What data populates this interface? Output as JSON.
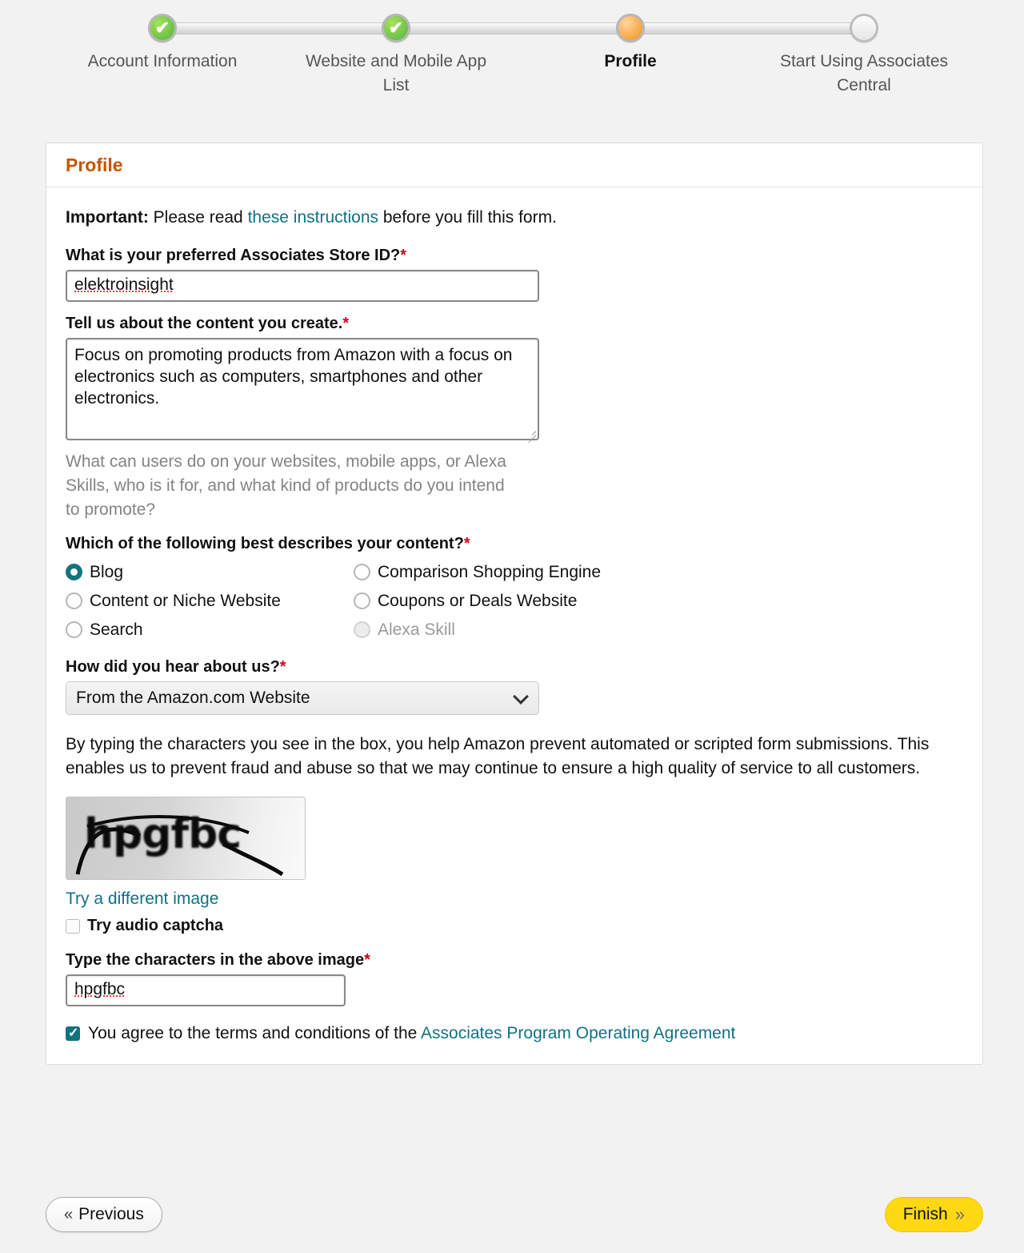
{
  "tracker": {
    "steps": [
      {
        "label": "Account Information",
        "state": "done",
        "icon": "check-icon"
      },
      {
        "label": "Website and Mobile App List",
        "state": "done",
        "icon": "check-icon"
      },
      {
        "label": "Profile",
        "state": "active",
        "icon": "current-step-icon"
      },
      {
        "label": "Start Using Associates Central",
        "state": "todo",
        "icon": "pending-step-icon"
      }
    ]
  },
  "card": {
    "title": "Profile",
    "important_prefix": "Important:",
    "important_text_before": " Please read ",
    "important_link": "these instructions",
    "important_text_after": " before you fill this form."
  },
  "fields": {
    "store_id": {
      "label": "What is your preferred Associates Store ID?",
      "required_mark": "*",
      "value": "elektroinsight"
    },
    "content_description": {
      "label": "Tell us about the content you create.",
      "required_mark": "*",
      "value": "Focus on promoting products from Amazon with a focus on electronics such as computers, smartphones and other electronics.",
      "hint": "What can users do on your websites, mobile apps, or Alexa Skills, who is it for, and what kind of products do you intend to promote?"
    },
    "content_type": {
      "label": "Which of the following best describes your content?",
      "required_mark": "*",
      "options": [
        {
          "label": "Blog",
          "selected": true,
          "disabled": false
        },
        {
          "label": "Comparison Shopping Engine",
          "selected": false,
          "disabled": false
        },
        {
          "label": "Content or Niche Website",
          "selected": false,
          "disabled": false
        },
        {
          "label": "Coupons or Deals Website",
          "selected": false,
          "disabled": false
        },
        {
          "label": "Search",
          "selected": false,
          "disabled": false
        },
        {
          "label": "Alexa Skill",
          "selected": false,
          "disabled": true
        }
      ]
    },
    "how_heard": {
      "label": "How did you hear about us?",
      "required_mark": "*",
      "value": "From the Amazon.com Website"
    }
  },
  "captcha": {
    "paragraph": "By typing the characters you see in the box, you help Amazon prevent automated or scripted form submissions. This enables us to prevent fraud and abuse so that we may continue to ensure a high quality of service to all customers.",
    "image_text": "hpgfbc",
    "try_different_link": "Try a different image",
    "audio_label": "Try audio captcha",
    "audio_checked": false,
    "input_label": "Type the characters in the above image",
    "required_mark": "*",
    "input_value": "hpgfbc"
  },
  "terms": {
    "checked": true,
    "text": "You agree to the terms and conditions of the ",
    "link": "Associates Program Operating Agreement"
  },
  "footer": {
    "previous_label": "Previous",
    "previous_glyph": "«",
    "finish_label": "Finish",
    "finish_glyph": "»"
  },
  "colors": {
    "page_bg": "#f2f2f2",
    "card_title": "#c45500",
    "link": "#0f7285",
    "accent_teal": "#12737f",
    "required": "#d0021b",
    "finish_yellow": "#ffd814",
    "step_done": "#6cc247",
    "step_active": "#f4a33f"
  }
}
